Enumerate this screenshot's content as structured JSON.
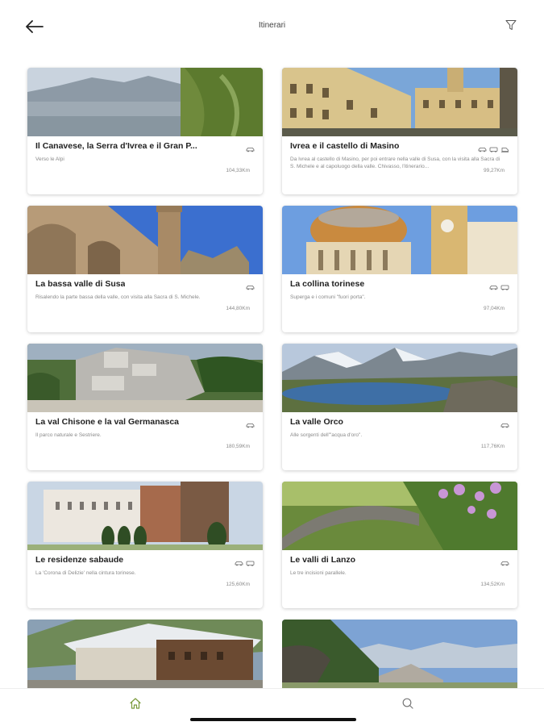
{
  "header": {
    "title": "Itinerari",
    "back_icon": "arrow-left-icon",
    "filter_icon": "filter-icon"
  },
  "itineraries": [
    {
      "name": "Il Canavese, la Serra d'Ivrea e il Gran P...",
      "description": "Verso le Alpi",
      "distance": "104,33Km",
      "modes": [
        "car-icon"
      ]
    },
    {
      "name": "Ivrea e il castello di Masino",
      "description": "Da Ivrea al castello di Masino, per poi entrare nella valle di Susa, con la visita alla Sacra di S. Michele e al capoluogo della valle. Chivasso, l'itinerario...",
      "distance": "99,27Km",
      "modes": [
        "car-icon",
        "bus-icon",
        "train-icon"
      ]
    },
    {
      "name": "La bassa valle di Susa",
      "description": "Risalendo la parte bassa della valle, con visita alla Sacra di S. Michele.",
      "distance": "144,80Km",
      "modes": [
        "car-icon"
      ]
    },
    {
      "name": "La collina torinese",
      "description": "Superga e i comuni \"fuori porta\".",
      "distance": "97,04Km",
      "modes": [
        "car-icon",
        "bus-icon"
      ]
    },
    {
      "name": "La val Chisone e la val Germanasca",
      "description": "Il parco naturale e Sestriere.",
      "distance": "180,59Km",
      "modes": [
        "car-icon"
      ]
    },
    {
      "name": "La valle Orco",
      "description": "Alle sorgenti dell'\"acqua d'oro\".",
      "distance": "117,76Km",
      "modes": [
        "car-icon"
      ]
    },
    {
      "name": "Le residenze sabaude",
      "description": "La 'Corona di Delizie' nella cintura torinese.",
      "distance": "125,60Km",
      "modes": [
        "car-icon",
        "bus-icon"
      ]
    },
    {
      "name": "Le valli di Lanzo",
      "description": "Le tre incisioni parallele.",
      "distance": "134,52Km",
      "modes": [
        "car-icon"
      ]
    }
  ],
  "bottom_nav": {
    "home_icon": "home-icon",
    "search_icon": "search-icon",
    "active_color": "#7a9a3a"
  }
}
